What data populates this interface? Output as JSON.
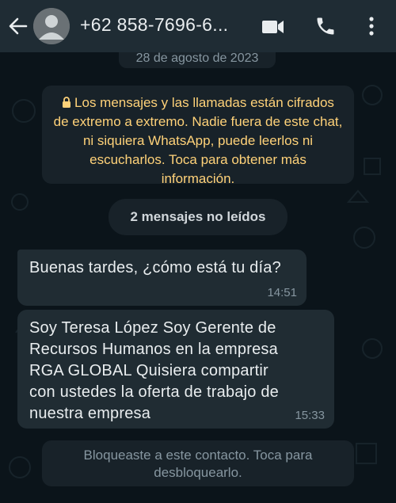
{
  "header": {
    "contact_name": "+62 858-7696-6...",
    "back_icon": "arrow-left-icon",
    "video_icon": "video-camera-icon",
    "call_icon": "phone-icon",
    "menu_icon": "more-vertical-icon"
  },
  "chat": {
    "date_label": "28 de agosto de 2023",
    "encryption_notice": "Los mensajes y las llamadas están cifrados de extremo a extremo. Nadie fuera de este chat, ni siquiera WhatsApp, puede leerlos ni escucharlos. Toca para obtener más información.",
    "unread_label": "2 mensajes no leídos",
    "messages": [
      {
        "text": "Buenas tardes, ¿cómo está tu día?",
        "time": "14:51"
      },
      {
        "text": "Soy Teresa López Soy Gerente de Recursos Humanos en la empresa RGA GLOBAL Quisiera compartir con ustedes la oferta de trabajo de nuestra empresa",
        "time": "15:33"
      }
    ],
    "blocked_notice": "Bloqueaste a este contacto. Toca para desbloquearlo."
  },
  "colors": {
    "background": "#0b141a",
    "header": "#1f2c34",
    "bubble_incoming": "#202c33",
    "system_pill": "#182229",
    "encryption_text": "#ffd279",
    "secondary_text": "#8696a0"
  }
}
